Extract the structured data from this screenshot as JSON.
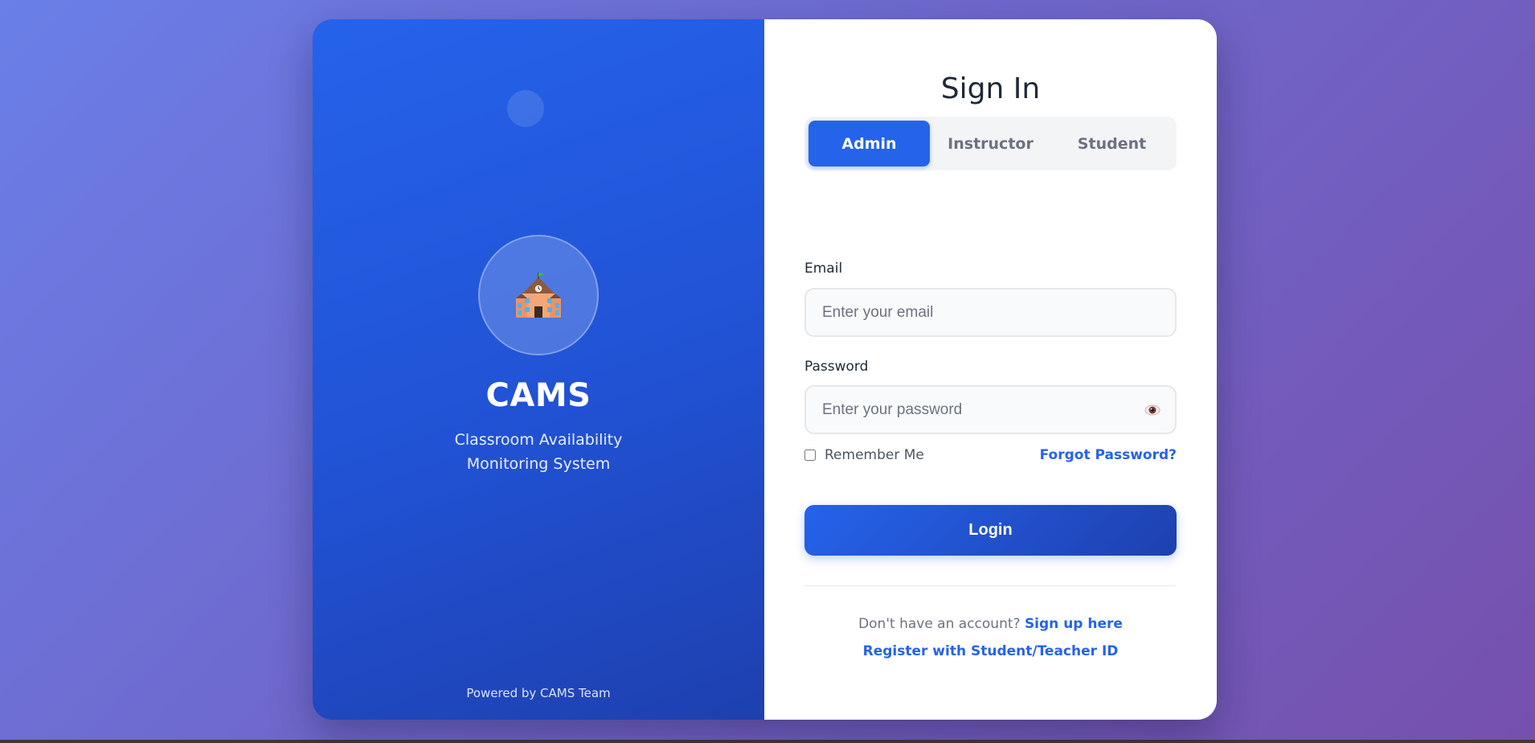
{
  "brand": {
    "name": "CAMS",
    "subtitle_line1": "Classroom Availability",
    "subtitle_line2": "Monitoring System",
    "powered_by": "Powered by CAMS Team",
    "logo_icon": "school-building-icon"
  },
  "signin": {
    "title": "Sign In",
    "tabs": [
      {
        "label": "Admin",
        "active": true
      },
      {
        "label": "Instructor",
        "active": false
      },
      {
        "label": "Student",
        "active": false
      }
    ]
  },
  "form": {
    "email_label": "Email",
    "email_placeholder": "Enter your email",
    "email_value": "",
    "password_label": "Password",
    "password_placeholder": "Enter your password",
    "password_value": "",
    "password_toggle_icon": "eye-icon",
    "remember_label": "Remember Me",
    "remember_checked": false,
    "forgot_label": "Forgot Password?",
    "login_label": "Login"
  },
  "footer": {
    "signup_prompt": "Don't have an account?",
    "signup_link": "Sign up here",
    "register_link": "Register with Student/Teacher ID"
  },
  "colors": {
    "accent": "#2563eb",
    "accent_dark": "#1e40af",
    "background_start": "#6a7fe8",
    "background_end": "#7650ad"
  }
}
